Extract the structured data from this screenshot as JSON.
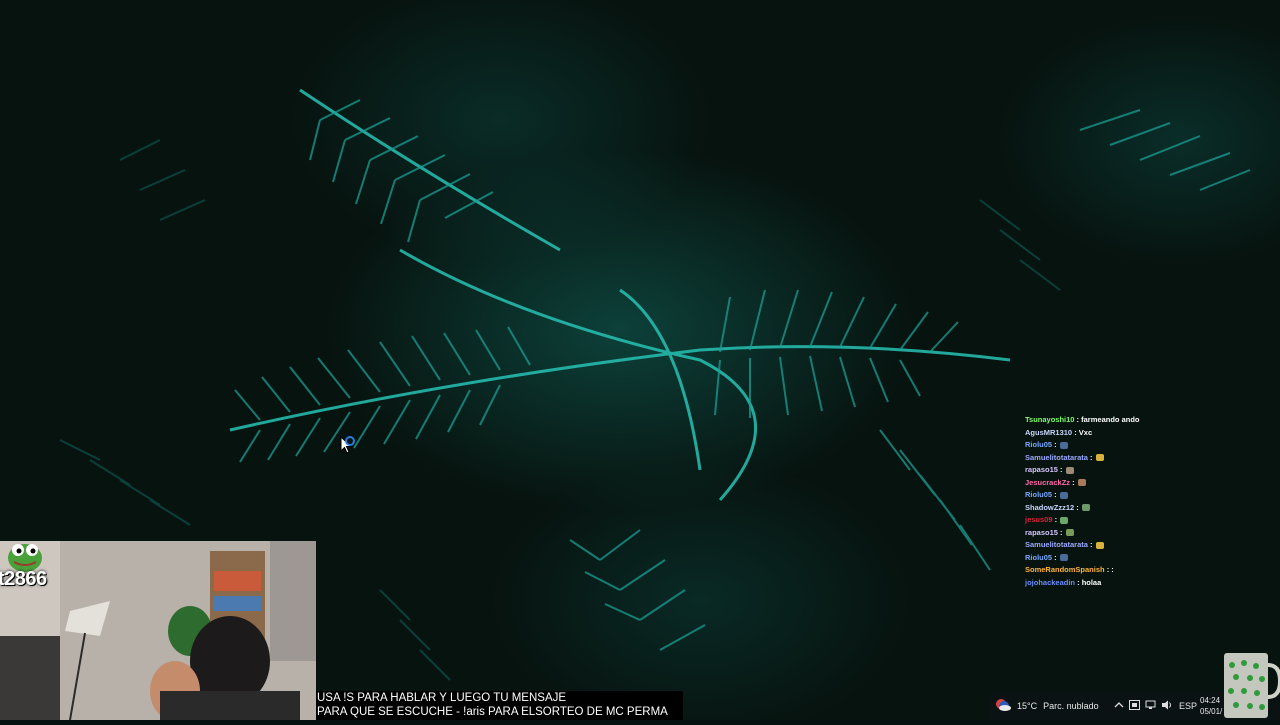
{
  "chat": {
    "messages": [
      {
        "user": "Tsunayoshi10",
        "color": "#7cff6b",
        "text": "farmeando ando",
        "emote": null
      },
      {
        "user": "AgusMR1310",
        "color": "#c9d6ff",
        "text": "Vxc",
        "emote": null
      },
      {
        "user": "Riolu05",
        "color": "#7aa8ff",
        "text": "",
        "emote": "#4a6a9a"
      },
      {
        "user": "Samuelitotatarata",
        "color": "#9aa8ff",
        "text": "",
        "emote": "#d8b23a"
      },
      {
        "user": "rapaso15",
        "color": "#d9c6ff",
        "text": "",
        "emote": "#9c8a72"
      },
      {
        "user": "JesucrackZz",
        "color": "#ff6aa8",
        "text": "",
        "emote": "#a87a5a"
      },
      {
        "user": "Riolu05",
        "color": "#7aa8ff",
        "text": "",
        "emote": "#4a6a9a"
      },
      {
        "user": "ShadowZzz12",
        "color": "#c9d6ff",
        "text": "",
        "emote": "#6c9a6a"
      },
      {
        "user": "jesus09",
        "color": "#e0203a",
        "text": "",
        "emote": "#6ba86a"
      },
      {
        "user": "rapaso15",
        "color": "#d9c6ff",
        "text": "",
        "emote": "#7a9a5a"
      },
      {
        "user": "Samuelitotatarata",
        "color": "#9aa8ff",
        "text": "",
        "emote": "#d8b23a"
      },
      {
        "user": "Riolu05",
        "color": "#7aa8ff",
        "text": "",
        "emote": "#4a6a9a"
      },
      {
        "user": "SomeRandomSpanish",
        "color": "#ffb43a",
        "text": ":",
        "emote": null
      },
      {
        "user": "jojohackeadin",
        "color": "#6a8cff",
        "text": "holaa",
        "emote": null
      }
    ]
  },
  "webcam": {
    "overlay_name": "t2866"
  },
  "ticker": {
    "line1": "USA !S PARA HABLAR Y LUEGO TU MENSAJE",
    "line2": "PARA QUE SE ESCUCHE - !aris PARA ELSORTEO DE MC PERMA"
  },
  "taskbar": {
    "weather_temp": "15°C",
    "weather_desc": "Parc. nublado",
    "language": "ESP",
    "time": "04:24",
    "date": "05/01/",
    "icons": [
      "weather-icon",
      "chevron-up-icon",
      "tray-app-icon",
      "network-icon",
      "volume-icon"
    ]
  }
}
